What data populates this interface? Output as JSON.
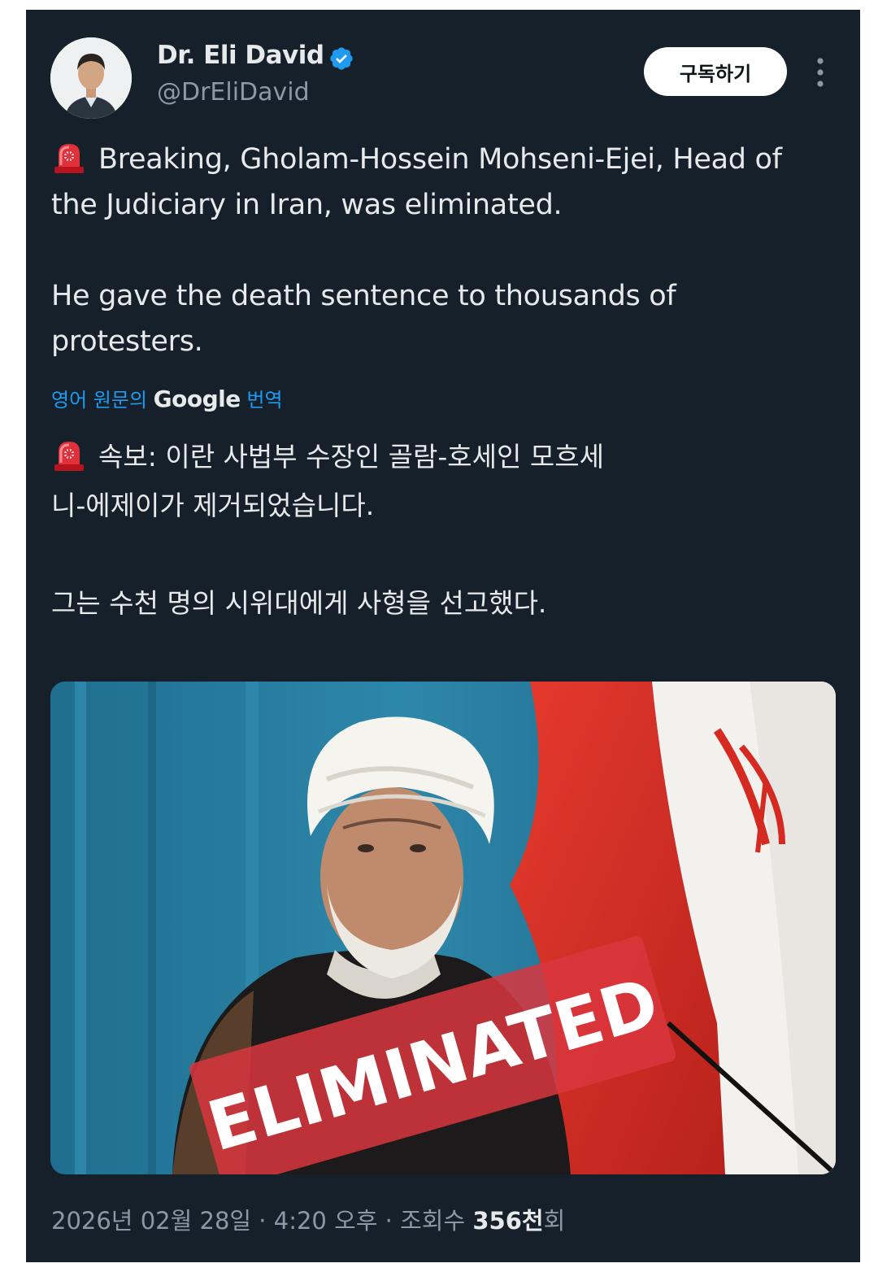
{
  "author": {
    "display_name": "Dr. Eli David",
    "handle": "@DrEliDavid",
    "verified_icon": "verified-badge-icon",
    "verified_color": "#1d9bf0"
  },
  "actions": {
    "subscribe_label": "구독하기",
    "more_icon": "more-vertical-icon"
  },
  "tweet": {
    "line1": "Breaking, Gholam-Hossein Mohseni-Ejei, Head of the Judiciary in Iran, was eliminated.",
    "line2": "He gave the death sentence to thousands of protesters.",
    "emoji_icon": "police-siren-icon"
  },
  "translation": {
    "prefix": "영어 원문의 ",
    "google": "Google",
    "suffix": " 번역",
    "line1": "속보: 이란 사법부 수장인 골람-호세인 모흐세니-에제이가 제거되었습니다.",
    "line2": "그는 수천 명의 시위대에게 사형을 선고했다."
  },
  "media": {
    "overlay_text": "ELIMINATED",
    "overlay_color": "#d9363e"
  },
  "meta": {
    "date": "2026년 02월 28일",
    "sep1": " · ",
    "time": "4:20 오후",
    "sep2": " · ",
    "views_label": "조회수 ",
    "views_number": "356천",
    "views_suffix": "회"
  },
  "colors": {
    "background": "#15202b",
    "text": "#e7e9ea",
    "secondary": "#8b98a5",
    "link": "#1d9bf0"
  }
}
